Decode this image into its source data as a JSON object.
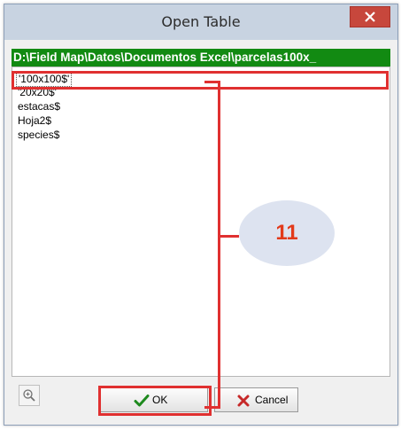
{
  "window": {
    "title": "Open Table",
    "close_icon": "close-icon"
  },
  "path_bar": {
    "text": "D:\\Field Map\\Datos\\Documentos Excel\\parcelas100x_"
  },
  "tables": {
    "items": [
      {
        "label": "'100x100$'",
        "selected": true
      },
      {
        "label": "'20x20$'",
        "selected": false
      },
      {
        "label": "estacas$",
        "selected": false
      },
      {
        "label": "Hoja2$",
        "selected": false
      },
      {
        "label": "species$",
        "selected": false
      }
    ]
  },
  "toolbar": {
    "zoom_icon": "zoom-in-icon",
    "ok_label": "OK",
    "ok_icon": "checkmark-icon",
    "cancel_label": "Cancel",
    "cancel_icon": "x-icon"
  },
  "annotation": {
    "callout_number": "11",
    "highlight_color": "#e03030",
    "callout_color": "#e23a1a"
  }
}
